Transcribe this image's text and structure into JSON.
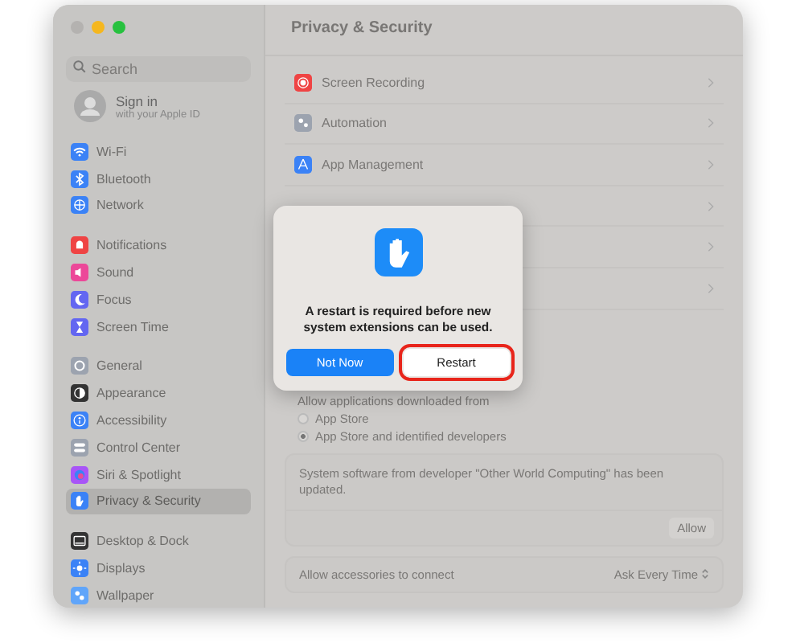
{
  "window": {
    "title": "Privacy & Security"
  },
  "search": {
    "placeholder": "Search"
  },
  "account": {
    "title": "Sign in",
    "subtitle": "with your Apple ID"
  },
  "sidebar": {
    "groups": [
      [
        {
          "label": "Wi-Fi",
          "selected": false
        },
        {
          "label": "Bluetooth",
          "selected": false
        },
        {
          "label": "Network",
          "selected": false
        }
      ],
      [
        {
          "label": "Notifications",
          "selected": false
        },
        {
          "label": "Sound",
          "selected": false
        },
        {
          "label": "Focus",
          "selected": false
        },
        {
          "label": "Screen Time",
          "selected": false
        }
      ],
      [
        {
          "label": "General",
          "selected": false
        },
        {
          "label": "Appearance",
          "selected": false
        },
        {
          "label": "Accessibility",
          "selected": false
        },
        {
          "label": "Control Center",
          "selected": false
        },
        {
          "label": "Siri & Spotlight",
          "selected": false
        },
        {
          "label": "Privacy & Security",
          "selected": true
        }
      ],
      [
        {
          "label": "Desktop & Dock",
          "selected": false
        },
        {
          "label": "Displays",
          "selected": false
        },
        {
          "label": "Wallpaper",
          "selected": false
        }
      ]
    ]
  },
  "rows": [
    {
      "label": "Screen Recording"
    },
    {
      "label": "Automation"
    },
    {
      "label": "App Management"
    }
  ],
  "downloads": {
    "label": "Allow applications downloaded from",
    "options": [
      {
        "label": "App Store",
        "selected": false
      },
      {
        "label": "App Store and identified developers",
        "selected": true
      }
    ]
  },
  "notice": {
    "text": "System software from developer \"Other World Computing\" has been updated.",
    "button": "Allow"
  },
  "accessories": {
    "label": "Allow accessories to connect",
    "value": "Ask Every Time"
  },
  "dialog": {
    "message": "A restart is required before new system extensions can be used.",
    "buttons": [
      {
        "label": "Not Now",
        "kind": "primary",
        "highlighted": false
      },
      {
        "label": "Restart",
        "kind": "default",
        "highlighted": true
      }
    ]
  }
}
